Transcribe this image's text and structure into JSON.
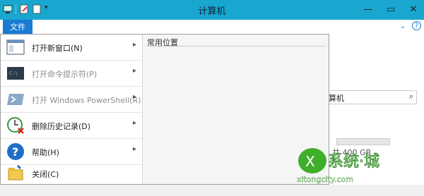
{
  "window": {
    "title": "计算机"
  },
  "ribbon": {
    "file_tab": "文件"
  },
  "menu": {
    "items": [
      {
        "label": "打开新窗口(N)",
        "icon": "window-icon",
        "disabled": false,
        "submenu": true
      },
      {
        "label": "打开命令提示符(P)",
        "icon": "cmd-icon",
        "disabled": true,
        "submenu": true
      },
      {
        "label": "打开 Windows PowerShell(R)",
        "icon": "powershell-icon",
        "disabled": true,
        "submenu": true
      },
      {
        "label": "删除历史记录(D)",
        "icon": "clear-history-icon",
        "disabled": false,
        "submenu": true
      },
      {
        "label": "帮助(H)",
        "icon": "help-icon",
        "disabled": false,
        "submenu": true
      },
      {
        "label": "关闭(C)",
        "icon": "close-folder-icon",
        "disabled": false,
        "submenu": false
      }
    ],
    "recent_title": "常用位置"
  },
  "background": {
    "search_text": "算机",
    "capacity_text": "共 400 GB"
  },
  "watermark": {
    "main": "系统城",
    "sub": "xitongcity.com"
  },
  "colors": {
    "titlebar": "#19a6cf",
    "file_tab": "#1a7bd3"
  }
}
